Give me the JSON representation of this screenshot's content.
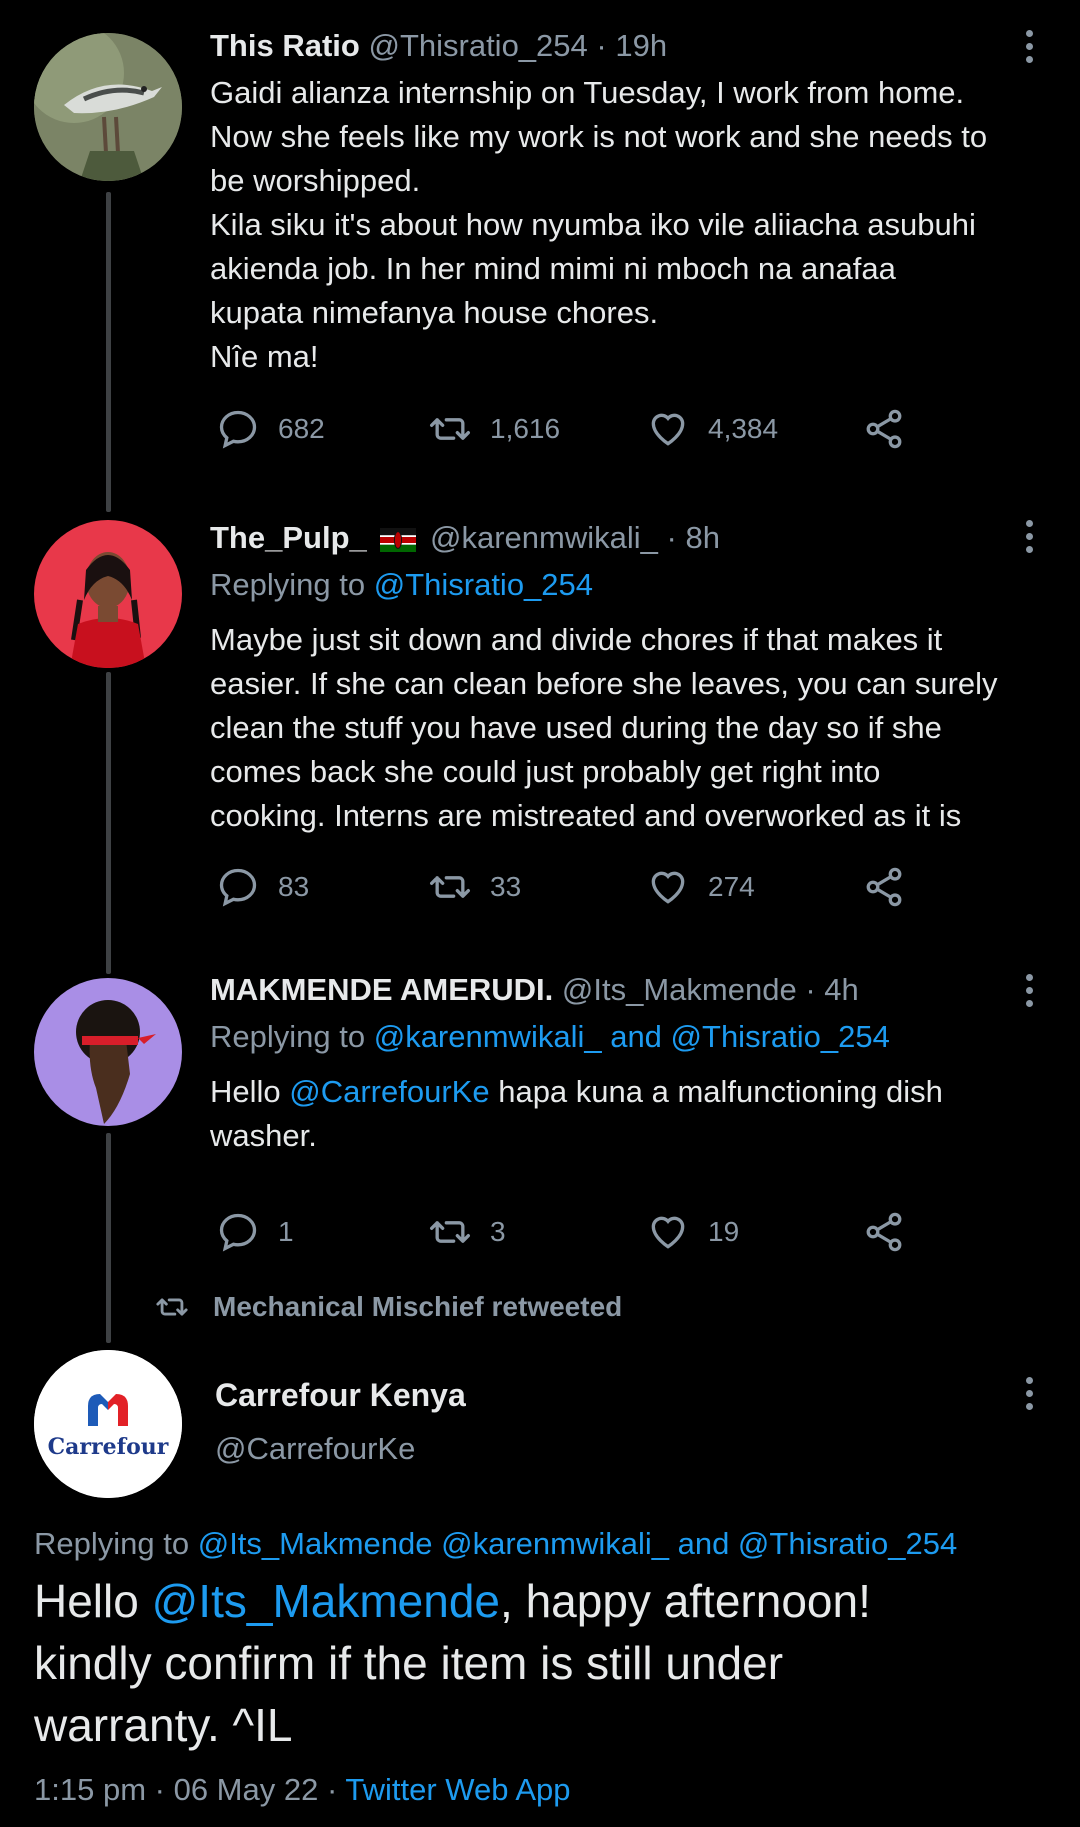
{
  "tweets": [
    {
      "name": "This Ratio",
      "handle": "@Thisratio_254",
      "time": "19h",
      "lines": [
        "Gaidi alianza internship on Tuesday, I work from home.",
        "Now she feels like my work is not work and she needs to",
        "be worshipped.",
        "Kila siku it's about how nyumba iko vile aliiacha asubuhi",
        "akienda job. In her mind mimi ni mboch na anafaa",
        "kupata nimefanya house chores.",
        "Nîe ma!"
      ],
      "replies": "682",
      "retweets": "1,616",
      "likes": "4,384"
    },
    {
      "name": "The_Pulp_",
      "handle": "@karenmwikali_",
      "time": "8h",
      "replying_prefix": "Replying to ",
      "replying_to": "@Thisratio_254",
      "lines": [
        "Maybe just sit down and divide chores if that makes it",
        "easier. If she can clean before she leaves, you can surely",
        "clean the stuff you have used during the day so if she",
        "comes back she could just probably get right into",
        "cooking. Interns are mistreated and overworked as it is"
      ],
      "replies": "83",
      "retweets": "33",
      "likes": "274"
    },
    {
      "name": "MAKMENDE AMERUDI.",
      "handle": "@Its_Makmende",
      "time": "4h",
      "replying_prefix": "Replying to ",
      "replying_to": "@karenmwikali_ and @Thisratio_254",
      "text_a": "Hello ",
      "mention": "@CarrefourKe",
      "text_b": " hapa kuna a malfunctioning dish",
      "text_c": "washer.",
      "replies": "1",
      "retweets": "3",
      "likes": "19"
    }
  ],
  "retweet_banner": "Mechanical Mischief retweeted",
  "main": {
    "avatar_text": "Carrefour",
    "name": "Carrefour Kenya",
    "handle": "@CarrefourKe",
    "replying_prefix": "Replying to ",
    "replying_to": "@Its_Makmende @karenmwikali_ and @Thisratio_254",
    "text_a": "Hello ",
    "mention": "@Its_Makmende",
    "text_b": ", happy afternoon!",
    "text_c": "kindly confirm if the item is still under",
    "text_d": "warranty. ^IL",
    "time": "1:15 pm",
    "date": "06 May 22",
    "source": "Twitter Web App"
  },
  "colors": {
    "background": "#000000",
    "text": "#e7e9ea",
    "muted": "#8b98a5",
    "link": "#1d9bf0"
  },
  "icons": [
    "reply-icon",
    "retweet-icon",
    "like-icon",
    "share-icon",
    "more-icon",
    "kenya-flag-icon"
  ]
}
